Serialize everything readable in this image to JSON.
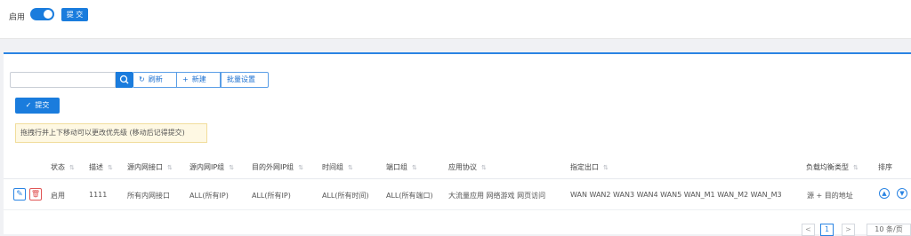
{
  "top": {
    "enable_label": "启用",
    "submit_label": "提 交"
  },
  "toolbar": {
    "search_placeholder": "",
    "refresh_label": "刷新",
    "new_label": "新建",
    "batch_label": "批量设置",
    "submit_label": "提交"
  },
  "notice": "拖拽行并上下移动可以更改优先级 (移动后记得提交)",
  "columns": [
    "状态",
    "描述",
    "源内网接口",
    "源内网IP组",
    "目的外网IP组",
    "时间组",
    "端口组",
    "应用协议",
    "指定出口",
    "负载均衡类型",
    "排序"
  ],
  "row": {
    "status": "启用",
    "desc": "1111",
    "src_if": "所有内网接口",
    "src_ip": "ALL(所有IP)",
    "dst_ip": "ALL(所有IP)",
    "time": "ALL(所有时间)",
    "port": "ALL(所有端口)",
    "app": "大流量应用 网络游戏 网页访问",
    "egress": "WAN WAN2 WAN3 WAN4 WAN5 WAN_M1 WAN_M2 WAN_M3",
    "lb_type": "源 + 目的地址"
  },
  "pager": {
    "prev": "<",
    "page": "1",
    "next": ">",
    "size": "10 条/页"
  },
  "icons": {
    "search": "search-icon",
    "refresh": "refresh-icon",
    "plus": "plus-icon",
    "check": "check-icon",
    "edit": "edit-icon",
    "delete": "trash-icon",
    "up": "chevron-up-icon",
    "down": "chevron-down-icon",
    "sort": "sort-icon"
  },
  "colors": {
    "primary": "#1a7cdd",
    "danger": "#e05555",
    "notice_bg": "#fef8e3"
  }
}
